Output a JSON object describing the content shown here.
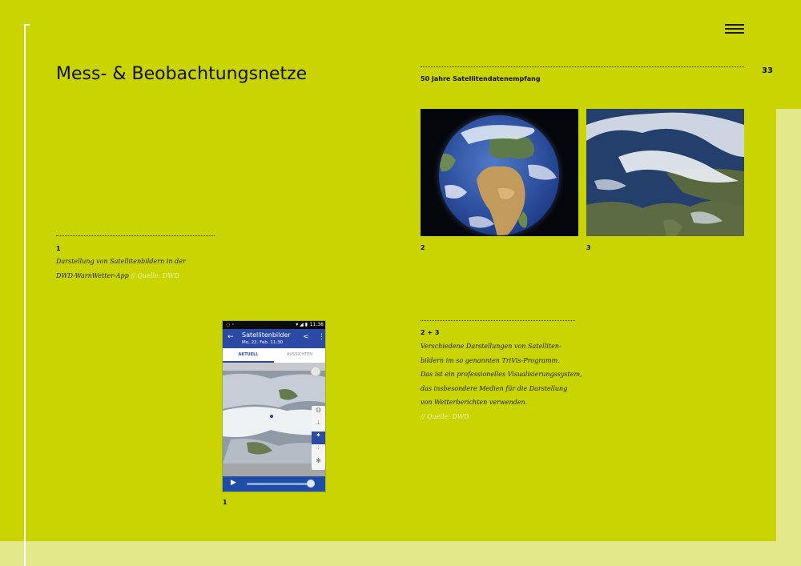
{
  "header": {
    "title": "Mess- & Beobachtungsnetze",
    "page_number": "33",
    "section_label": "50 Jahre Satellitendatenempfang"
  },
  "figure1": {
    "number": "1",
    "caption_lines": [
      "Darstellung von Satellitenbildern in der",
      "DWD-WarnWetter-App"
    ],
    "source": "// Quelle: DWD",
    "image_label": "1"
  },
  "figure2": {
    "label": "2"
  },
  "figure3": {
    "label": "3"
  },
  "figures23": {
    "number": "2 + 3",
    "caption_lines": [
      "Verschiedene Darstellungen von Satelliten-",
      "bildern im so genannten TriVis-Programm.",
      "Das ist ein professionelles Visualisierungssystem,",
      "das insbesondere Medien für die Darstellung",
      "von Wetterberichten verwenden."
    ],
    "source": "// Quelle: DWD"
  },
  "phone_app": {
    "status_time": "11:38",
    "title": "Satellitenbilder",
    "subtitle": "Mo, 22. Feb. 11:30",
    "tabs": [
      "AKTUELL",
      "AUSSICHTEN"
    ],
    "active_tab": 0
  },
  "icons": {
    "menu": "hamburger-menu-icon",
    "back": "arrow-left-icon",
    "share": "share-icon",
    "more": "more-vert-icon",
    "play": "play-icon",
    "satellite": "satellite-icon",
    "locate": "target-icon"
  },
  "colors": {
    "background": "#cad400",
    "pale_panel": "#e3e98a",
    "app_bar": "#2a4aa5",
    "source_text": "#eef2b8"
  }
}
